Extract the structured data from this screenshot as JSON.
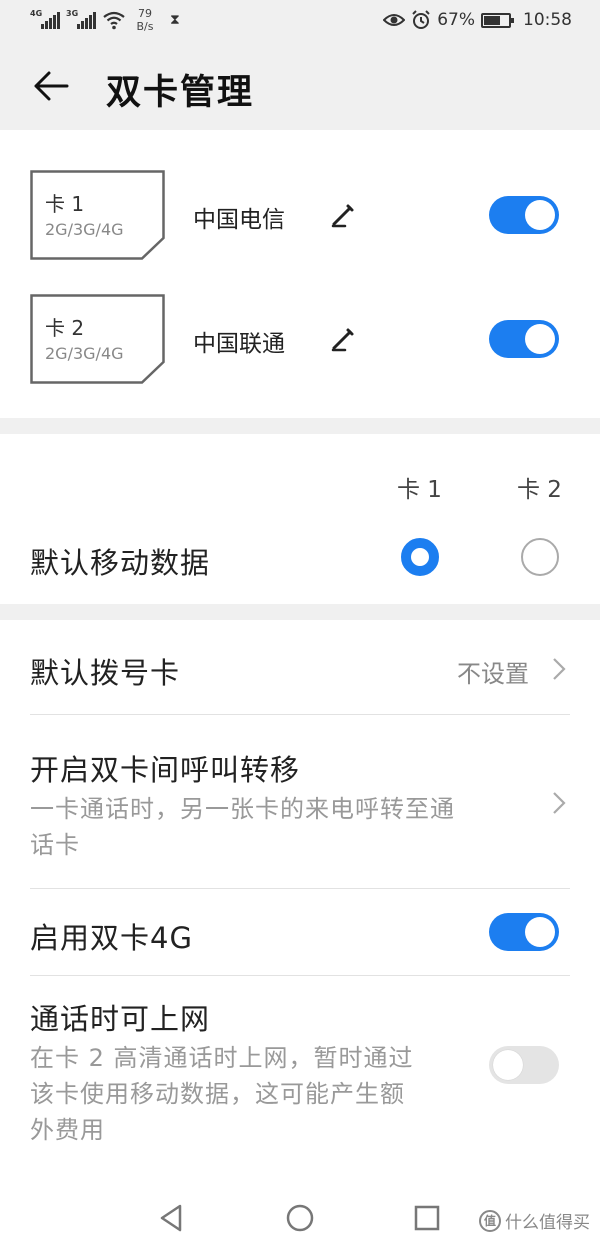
{
  "status_bar": {
    "signal1_tag": "4G",
    "signal2_tag": "3G",
    "speed_value": "79",
    "speed_unit": "B/s",
    "battery_percent": "67%",
    "battery_level": 0.67,
    "time": "10:58"
  },
  "header": {
    "title": "双卡管理",
    "back_icon": "arrow-left-icon"
  },
  "sims": [
    {
      "name": "卡 1",
      "network": "2G/3G/4G",
      "carrier": "中国电信",
      "enabled": true
    },
    {
      "name": "卡 2",
      "network": "2G/3G/4G",
      "carrier": "中国联通",
      "enabled": true
    }
  ],
  "default_data": {
    "col1": "卡 1",
    "col2": "卡 2",
    "label": "默认移动数据",
    "selected": "卡 1"
  },
  "settings": {
    "default_dial": {
      "label": "默认拨号卡",
      "value": "不设置"
    },
    "call_forward": {
      "label": "开启双卡间呼叫转移",
      "desc_line1": "一卡通话时，另一张卡的来电呼转至通",
      "desc_line2": "话卡"
    },
    "dual_4g": {
      "label": "启用双卡4G",
      "enabled": true
    },
    "data_during_call": {
      "label": "通话时可上网",
      "desc_line1": "在卡 2 高清通话时上网，暂时通过",
      "desc_line2": "该卡使用移动数据，这可能产生额",
      "desc_line3": "外费用",
      "enabled": false
    }
  },
  "watermark": {
    "badge": "值",
    "text": "什么值得买"
  },
  "colors": {
    "accent": "#1c7ef0",
    "background_gray": "#f0f0f0"
  }
}
